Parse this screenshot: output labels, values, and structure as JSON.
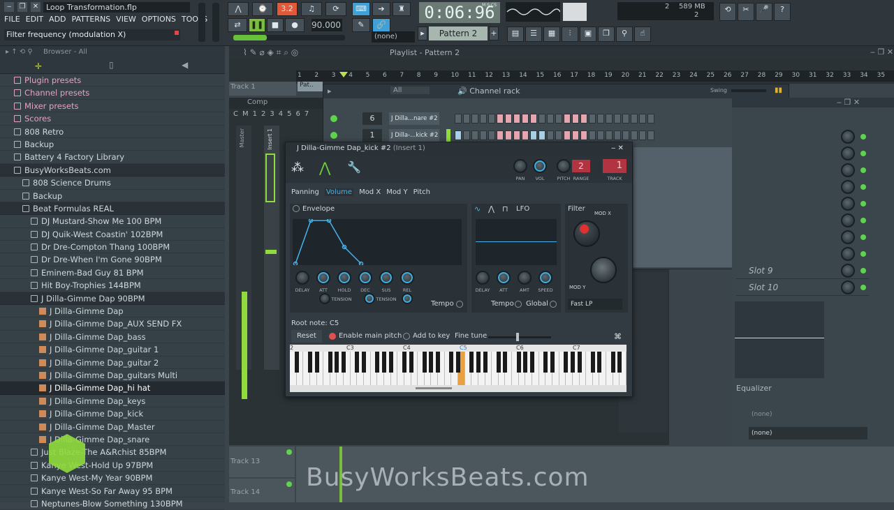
{
  "app": {
    "title": "Loop Transformation.flp",
    "hint": "Filter frequency (modulation X)",
    "menu": [
      "FILE",
      "EDIT",
      "ADD",
      "PATTERNS",
      "VIEW",
      "OPTIONS",
      "TOOLS",
      "?"
    ],
    "time": "0:06:96",
    "time_unit": "M:S:CS",
    "tempo": "90.000",
    "pattern": "Pattern 2",
    "none_select": "(none)",
    "memory": "589 MB",
    "cpu": "2",
    "voices": "2",
    "snap": "2"
  },
  "browser": {
    "header": "Browser - All",
    "items": [
      {
        "label": "Plugin presets",
        "type": "pink",
        "indent": 0
      },
      {
        "label": "Channel presets",
        "type": "pink",
        "indent": 0
      },
      {
        "label": "Mixer presets",
        "type": "pink",
        "indent": 0
      },
      {
        "label": "Scores",
        "type": "pink",
        "indent": 0
      },
      {
        "label": "808 Retro",
        "type": "folder",
        "indent": 0
      },
      {
        "label": "Backup",
        "type": "folder",
        "indent": 0
      },
      {
        "label": "Battery 4 Factory Library",
        "type": "folder",
        "indent": 0
      },
      {
        "label": "BusyWorksBeats.com",
        "type": "folder",
        "indent": 0,
        "sel": true
      },
      {
        "label": "808 Science Drums",
        "type": "folder",
        "indent": 1
      },
      {
        "label": "Backup",
        "type": "folder",
        "indent": 1
      },
      {
        "label": "Beat Formulas REAL",
        "type": "folder",
        "indent": 1,
        "sel": true
      },
      {
        "label": "DJ Mustard-Show Me 100 BPM",
        "type": "folder",
        "indent": 2
      },
      {
        "label": "DJ Quik-West Coastin' 102BPM",
        "type": "folder",
        "indent": 2
      },
      {
        "label": "Dr Dre-Compton Thang 100BPM",
        "type": "folder",
        "indent": 2
      },
      {
        "label": "Dr Dre-When I'm Gone 90BPM",
        "type": "folder",
        "indent": 2
      },
      {
        "label": "Eminem-Bad Guy 81 BPM",
        "type": "folder",
        "indent": 2
      },
      {
        "label": "Hit Boy-Trophies 144BPM",
        "type": "folder",
        "indent": 2
      },
      {
        "label": "J Dilla-Gimme Dap 90BPM",
        "type": "folder",
        "indent": 2,
        "sel": true
      },
      {
        "label": "J Dilla-Gimme Dap",
        "type": "file",
        "indent": 3
      },
      {
        "label": "J Dilla-Gimme Dap_AUX SEND FX",
        "type": "file",
        "indent": 3
      },
      {
        "label": "J Dilla-Gimme Dap_bass",
        "type": "file",
        "indent": 3
      },
      {
        "label": "J Dilla-Gimme Dap_guitar 1",
        "type": "file",
        "indent": 3
      },
      {
        "label": "J Dilla-Gimme Dap_guitar 2",
        "type": "file",
        "indent": 3
      },
      {
        "label": "J Dilla-Gimme Dap_guitars Multi",
        "type": "file",
        "indent": 3
      },
      {
        "label": "J Dilla-Gimme Dap_hi hat",
        "type": "file",
        "indent": 3,
        "hl": true
      },
      {
        "label": "J Dilla-Gimme Dap_keys",
        "type": "file",
        "indent": 3
      },
      {
        "label": "J Dilla-Gimme Dap_kick",
        "type": "file",
        "indent": 3
      },
      {
        "label": "J Dilla-Gimme Dap_Master",
        "type": "file",
        "indent": 3
      },
      {
        "label": "J Dilla-Gimme Dap_snare",
        "type": "file",
        "indent": 3
      },
      {
        "label": "Just Blaze-The A&Rchist 85BPM",
        "type": "folder",
        "indent": 2
      },
      {
        "label": "Kanye West-Hold Up 97BPM",
        "type": "folder",
        "indent": 2
      },
      {
        "label": "Kanye West-My Year 90BPM",
        "type": "folder",
        "indent": 2
      },
      {
        "label": "Kanye West-So Far Away 95 BPM",
        "type": "folder",
        "indent": 2
      },
      {
        "label": "Neptunes-Blow Something 130BPM",
        "type": "folder",
        "indent": 2
      }
    ]
  },
  "playlist": {
    "title": "Playlist - Pattern 2",
    "track1": "Track 1",
    "track13": "Track 13",
    "track14": "Track 14",
    "clip": "Pat..",
    "ruler": [
      "1",
      "2",
      "3",
      "4",
      "5",
      "6",
      "7",
      "8",
      "9",
      "10",
      "11",
      "12",
      "13",
      "14",
      "15",
      "16",
      "17",
      "18",
      "19",
      "20",
      "21",
      "22",
      "23",
      "24",
      "25",
      "26",
      "27",
      "28",
      "29",
      "30",
      "31",
      "32",
      "33",
      "34",
      "35"
    ]
  },
  "mixer": {
    "title": "Comp",
    "track_labels": [
      "C",
      "M",
      "1",
      "2",
      "3",
      "4",
      "5",
      "6",
      "7"
    ],
    "master": "Master",
    "insert": "Insert 1"
  },
  "channel_rack": {
    "title": "Channel rack",
    "filter": "All",
    "swing": "Swing",
    "channels": [
      {
        "number": "6",
        "name": "J Dilla...nare #2"
      },
      {
        "number": "1",
        "name": "J Dilla-...kick #2"
      }
    ]
  },
  "plugin": {
    "title": "J Dilla-Gimme Dap_kick #2",
    "insert": "(Insert 1)",
    "pan_label": "PAN",
    "vol_label": "VOL",
    "pitch_label": "PITCH",
    "range_label": "RANGE",
    "range_value": "2",
    "track_label": "TRACK",
    "track_value": "1",
    "tabs": [
      "Panning",
      "Volume",
      "Mod X",
      "Mod Y",
      "Pitch"
    ],
    "active_tab": "Volume",
    "envelope_label": "Envelope",
    "lfo_label": "LFO",
    "filter_label": "Filter",
    "modx_label": "MOD X",
    "mody_label": "MOD Y",
    "env_knobs": [
      "DELAY",
      "ATT",
      "HOLD",
      "DEC",
      "SUS",
      "REL"
    ],
    "tension_label": "TENSION",
    "lfo_knobs": [
      "DELAY",
      "ATT",
      "AMT",
      "SPEED"
    ],
    "tempo_label": "Tempo",
    "global_label": "Global",
    "filter_type": "Fast LP",
    "root_note": "Root note: C5",
    "reset": "Reset",
    "enable_pitch": "Enable main pitch",
    "add_to_key": "Add to key",
    "fine_tune": "Fine tune",
    "octaves": [
      "2",
      "C3",
      "C4",
      "C5",
      "C6",
      "C7",
      "C"
    ]
  },
  "right_panel": {
    "slots": [
      "Slot 9",
      "Slot 10"
    ],
    "equalizer": "Equalizer",
    "none1": "(none)",
    "none2": "(none)"
  },
  "watermark": "BusyWorksBeats.com"
}
